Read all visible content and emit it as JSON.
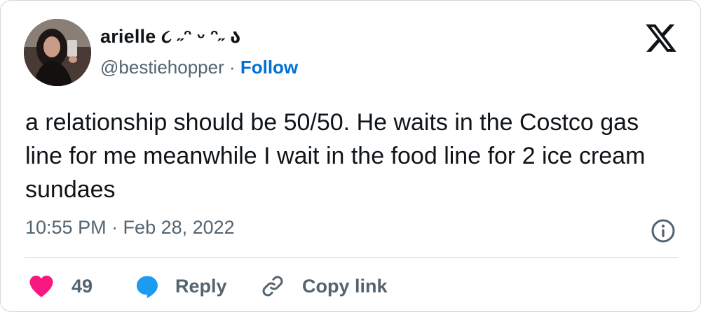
{
  "user": {
    "display_name": "arielle ૮ ˶ᵔ ᵕ ᵔ˶ ა",
    "handle": "@bestiehopper",
    "separator": " · ",
    "follow_label": "Follow"
  },
  "tweet": {
    "text": "a relationship should be 50/50. He waits in the Costco gas line for me meanwhile I wait in the food line for 2 ice cream sundaes",
    "timestamp": "10:55 PM · Feb 28, 2022"
  },
  "actions": {
    "like_count": "49",
    "reply_label": "Reply",
    "copy_link_label": "Copy link"
  },
  "icons": {
    "like": "heart-icon",
    "reply": "speech-bubble-icon",
    "copy_link": "link-icon",
    "info": "info-icon",
    "brand": "x-logo-icon"
  },
  "colors": {
    "text": "#0f1419",
    "secondary": "#536471",
    "follow": "#006fd6",
    "like": "#f91880",
    "reply": "#1d9bf0",
    "border": "#cfd9de"
  }
}
